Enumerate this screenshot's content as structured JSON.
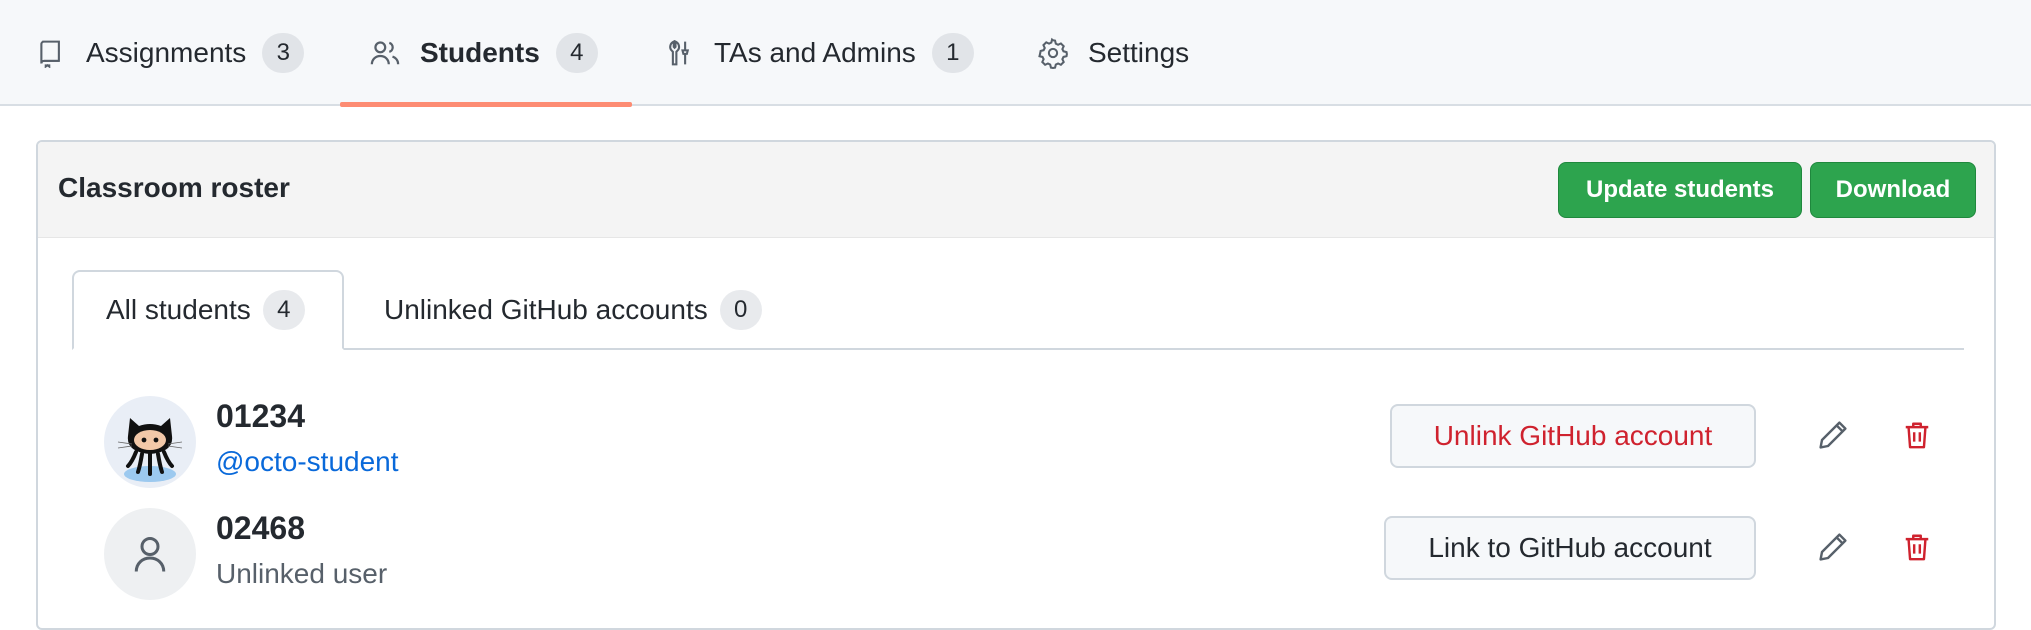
{
  "nav": {
    "tabs": [
      {
        "label": "Assignments",
        "count": "3",
        "icon": "book-icon"
      },
      {
        "label": "Students",
        "count": "4",
        "icon": "people-icon"
      },
      {
        "label": "TAs and Admins",
        "count": "1",
        "icon": "tools-icon"
      },
      {
        "label": "Settings",
        "icon": "gear-icon"
      }
    ],
    "active_tab": "Students",
    "underline_color": "#fd8c73"
  },
  "roster": {
    "title": "Classroom roster",
    "update_button": "Update students",
    "download_button": "Download",
    "subtabs": [
      {
        "label": "All students",
        "count": "4"
      },
      {
        "label": "Unlinked GitHub accounts",
        "count": "0"
      }
    ],
    "students": [
      {
        "id": "01234",
        "handle": "@octo-student",
        "action": "Unlink GitHub account",
        "avatar": "octocat-avatar"
      },
      {
        "id": "02468",
        "status": "Unlinked user",
        "action": "Link to GitHub account",
        "avatar": "person-icon"
      }
    ]
  },
  "colors": {
    "green": "#2da44e",
    "danger": "#cf222e",
    "link": "#0969da"
  }
}
